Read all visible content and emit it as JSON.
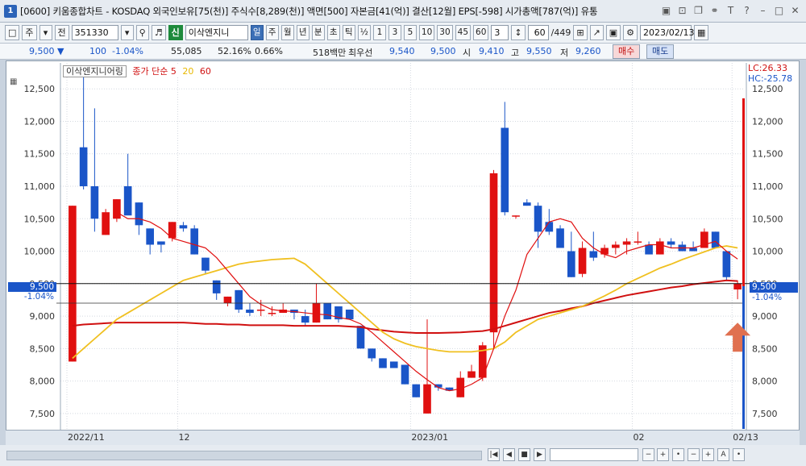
{
  "window": {
    "app_icon": "1",
    "title": "[0600] 키움종합차트 - KOSDAQ 외국인보유[75(천)] 주식수[8,289(천)] 액면[500] 자본금[41(억)] 결산[12월] EPS[-598] 시가총액[787(억)] 유통",
    "buttons": [
      "▣",
      "⊡",
      "❐",
      "⚭",
      "T",
      "?",
      "–",
      "□",
      "✕"
    ]
  },
  "toolbar": {
    "period": "주",
    "market": "전",
    "code": "351330",
    "stock_badge": "신",
    "stock_name": "이삭엔지니",
    "periods": [
      "일",
      "주",
      "월",
      "년",
      "분",
      "초",
      "틱"
    ],
    "active_period": "일",
    "fraction": "½",
    "intervals": [
      "1",
      "3",
      "5",
      "10",
      "30",
      "45",
      "60"
    ],
    "interval_value": "3",
    "count": "60",
    "count_total": "/449",
    "date": "2023/02/13"
  },
  "quote": {
    "price": "9,500",
    "change": "100",
    "change_pct": "-1.04%",
    "volume": "55,085",
    "ratio1": "52.16%",
    "ratio2": "0.66%",
    "amount": "518백만",
    "best_label": "최우선",
    "best_ask": "9,540",
    "best_bid": "9,500",
    "open_label": "시",
    "open": "9,410",
    "high_label": "고",
    "high": "9,550",
    "low_label": "저",
    "low": "9,260",
    "buy_label": "매수",
    "sell_label": "매도"
  },
  "legend": {
    "code": "이삭엔지니어링",
    "ma_label": "종가 단순",
    "ma5": "5",
    "ma20": "20",
    "ma60": "60"
  },
  "right_labels": {
    "lc": "LC:26.33",
    "hc": "HC:-25.78",
    "price": "9,500",
    "pct": "-1.04%"
  },
  "left_labels": {
    "price": "9,500",
    "pct": "-1.04%"
  },
  "colors": {
    "up": "#e01010",
    "down": "#1a55c8",
    "ma5": "#e01010",
    "ma20": "#f0c020",
    "ma60": "#d01010",
    "arrow": "#e07050"
  },
  "chart_data": {
    "type": "candlestick",
    "y_ticks": [
      12500,
      12000,
      11500,
      11000,
      10500,
      10000,
      9500,
      9000,
      8500,
      8000,
      7500
    ],
    "y_tick_labels": [
      "12,500",
      "12,000",
      "11,500",
      "11,000",
      "10,500",
      "10,000",
      "9,500",
      "9,000",
      "8,500",
      "8,000",
      "7,500"
    ],
    "ylim": [
      7250,
      12900
    ],
    "x_labels": [
      {
        "label": "2022/11",
        "index": 0
      },
      {
        "label": "12",
        "index": 10
      },
      {
        "label": "2023/01",
        "index": 31
      },
      {
        "label": "02",
        "index": 51
      },
      {
        "label": "02/13",
        "index": 60
      }
    ],
    "candles": [
      {
        "o": 8300,
        "h": 10700,
        "l": 8300,
        "c": 10700
      },
      {
        "o": 11600,
        "h": 12800,
        "l": 10950,
        "c": 11000
      },
      {
        "o": 11000,
        "h": 12200,
        "l": 10300,
        "c": 10500
      },
      {
        "o": 10250,
        "h": 10650,
        "l": 10250,
        "c": 10600
      },
      {
        "o": 10500,
        "h": 10800,
        "l": 10450,
        "c": 10800
      },
      {
        "o": 11000,
        "h": 11500,
        "l": 10600,
        "c": 10550
      },
      {
        "o": 10750,
        "h": 10750,
        "l": 10250,
        "c": 10400
      },
      {
        "o": 10350,
        "h": 10350,
        "l": 9950,
        "c": 10100
      },
      {
        "o": 10150,
        "h": 10150,
        "l": 9980,
        "c": 10100
      },
      {
        "o": 10200,
        "h": 10450,
        "l": 10150,
        "c": 10450
      },
      {
        "o": 10400,
        "h": 10450,
        "l": 10300,
        "c": 10350
      },
      {
        "o": 10350,
        "h": 10400,
        "l": 9950,
        "c": 9950
      },
      {
        "o": 9900,
        "h": 9900,
        "l": 9650,
        "c": 9700
      },
      {
        "o": 9550,
        "h": 9550,
        "l": 9250,
        "c": 9350
      },
      {
        "o": 9200,
        "h": 9300,
        "l": 9150,
        "c": 9300
      },
      {
        "o": 9400,
        "h": 9400,
        "l": 9050,
        "c": 9100
      },
      {
        "o": 9100,
        "h": 9200,
        "l": 9000,
        "c": 9050
      },
      {
        "o": 9100,
        "h": 9250,
        "l": 9000,
        "c": 9100
      },
      {
        "o": 9050,
        "h": 9150,
        "l": 9000,
        "c": 9050
      },
      {
        "o": 9050,
        "h": 9200,
        "l": 9050,
        "c": 9100
      },
      {
        "o": 9100,
        "h": 9100,
        "l": 8950,
        "c": 9050
      },
      {
        "o": 9000,
        "h": 9100,
        "l": 8850,
        "c": 8900
      },
      {
        "o": 8900,
        "h": 9500,
        "l": 8900,
        "c": 9200
      },
      {
        "o": 9200,
        "h": 9200,
        "l": 8950,
        "c": 8950
      },
      {
        "o": 9150,
        "h": 9150,
        "l": 8900,
        "c": 8950
      },
      {
        "o": 9100,
        "h": 9100,
        "l": 8950,
        "c": 8950
      },
      {
        "o": 8850,
        "h": 8850,
        "l": 8500,
        "c": 8500
      },
      {
        "o": 8500,
        "h": 8500,
        "l": 8300,
        "c": 8350
      },
      {
        "o": 8350,
        "h": 8350,
        "l": 8200,
        "c": 8200
      },
      {
        "o": 8300,
        "h": 8300,
        "l": 8200,
        "c": 8200
      },
      {
        "o": 8250,
        "h": 8250,
        "l": 7950,
        "c": 7950
      },
      {
        "o": 7950,
        "h": 7950,
        "l": 7750,
        "c": 7750
      },
      {
        "o": 7500,
        "h": 8950,
        "l": 7500,
        "c": 7950
      },
      {
        "o": 7950,
        "h": 7950,
        "l": 7850,
        "c": 7900
      },
      {
        "o": 7900,
        "h": 7900,
        "l": 7850,
        "c": 7850
      },
      {
        "o": 7750,
        "h": 8150,
        "l": 7750,
        "c": 8050
      },
      {
        "o": 8050,
        "h": 8250,
        "l": 8050,
        "c": 8150
      },
      {
        "o": 8050,
        "h": 8600,
        "l": 8000,
        "c": 8550
      },
      {
        "o": 8750,
        "h": 11250,
        "l": 8500,
        "c": 11200
      },
      {
        "o": 11900,
        "h": 12300,
        "l": 10550,
        "c": 10600
      },
      {
        "o": 10550,
        "h": 10550,
        "l": 10500,
        "c": 10550
      },
      {
        "o": 10750,
        "h": 10800,
        "l": 10700,
        "c": 10700
      },
      {
        "o": 10700,
        "h": 10750,
        "l": 10050,
        "c": 10300
      },
      {
        "o": 10450,
        "h": 10650,
        "l": 10250,
        "c": 10300
      },
      {
        "o": 10350,
        "h": 10400,
        "l": 10050,
        "c": 10050
      },
      {
        "o": 10000,
        "h": 10300,
        "l": 9600,
        "c": 9600
      },
      {
        "o": 9650,
        "h": 10150,
        "l": 9600,
        "c": 10050
      },
      {
        "o": 10000,
        "h": 10300,
        "l": 9850,
        "c": 9900
      },
      {
        "o": 9950,
        "h": 10100,
        "l": 9900,
        "c": 10050
      },
      {
        "o": 10050,
        "h": 10150,
        "l": 9950,
        "c": 10100
      },
      {
        "o": 10100,
        "h": 10200,
        "l": 9950,
        "c": 10150
      },
      {
        "o": 10150,
        "h": 10300,
        "l": 10100,
        "c": 10150
      },
      {
        "o": 10100,
        "h": 10150,
        "l": 9950,
        "c": 9950
      },
      {
        "o": 9950,
        "h": 10200,
        "l": 9950,
        "c": 10150
      },
      {
        "o": 10150,
        "h": 10200,
        "l": 10050,
        "c": 10100
      },
      {
        "o": 10100,
        "h": 10150,
        "l": 10000,
        "c": 10000
      },
      {
        "o": 10050,
        "h": 10150,
        "l": 10000,
        "c": 10000
      },
      {
        "o": 10050,
        "h": 10350,
        "l": 10050,
        "c": 10300
      },
      {
        "o": 10300,
        "h": 10300,
        "l": 10050,
        "c": 10050
      },
      {
        "o": 10000,
        "h": 10000,
        "l": 9550,
        "c": 9600
      },
      {
        "o": 9410,
        "h": 9550,
        "l": 9260,
        "c": 9500
      }
    ],
    "ma5": [
      null,
      null,
      null,
      null,
      10600,
      10500,
      10500,
      10450,
      10350,
      10200,
      10150,
      10100,
      10050,
      9900,
      9700,
      9500,
      9300,
      9180,
      9100,
      9080,
      9070,
      9050,
      9030,
      9020,
      8980,
      8950,
      8880,
      8750,
      8600,
      8450,
      8300,
      8150,
      8020,
      7900,
      7850,
      7880,
      7950,
      8050,
      8500,
      9000,
      9400,
      9950,
      10200,
      10450,
      10500,
      10450,
      10200,
      10050,
      9950,
      9900,
      10000,
      10050,
      10100,
      10100,
      10050,
      10050,
      10050,
      10100,
      10150,
      10000,
      9880
    ],
    "ma20": [
      8350,
      8500,
      8650,
      8800,
      8950,
      9050,
      9150,
      9250,
      9350,
      9450,
      9550,
      9600,
      9650,
      9700,
      9750,
      9800,
      9830,
      9850,
      9870,
      9880,
      9890,
      9800,
      9650,
      9500,
      9350,
      9200,
      9050,
      8900,
      8750,
      8650,
      8580,
      8530,
      8500,
      8470,
      8450,
      8450,
      8450,
      8470,
      8500,
      8600,
      8750,
      8850,
      8950,
      9000,
      9050,
      9100,
      9150,
      9230,
      9310,
      9400,
      9500,
      9580,
      9660,
      9740,
      9800,
      9870,
      9930,
      9990,
      10050,
      10080,
      10050
    ],
    "ma60": [
      8850,
      8870,
      8880,
      8890,
      8900,
      8900,
      8900,
      8900,
      8900,
      8900,
      8900,
      8890,
      8880,
      8880,
      8870,
      8870,
      8860,
      8860,
      8860,
      8860,
      8850,
      8850,
      8850,
      8850,
      8850,
      8840,
      8830,
      8800,
      8780,
      8760,
      8750,
      8740,
      8740,
      8740,
      8745,
      8750,
      8760,
      8770,
      8800,
      8850,
      8900,
      8950,
      9000,
      9050,
      9080,
      9120,
      9150,
      9200,
      9240,
      9280,
      9320,
      9350,
      9380,
      9410,
      9440,
      9460,
      9490,
      9510,
      9530,
      9550,
      9540
    ]
  }
}
